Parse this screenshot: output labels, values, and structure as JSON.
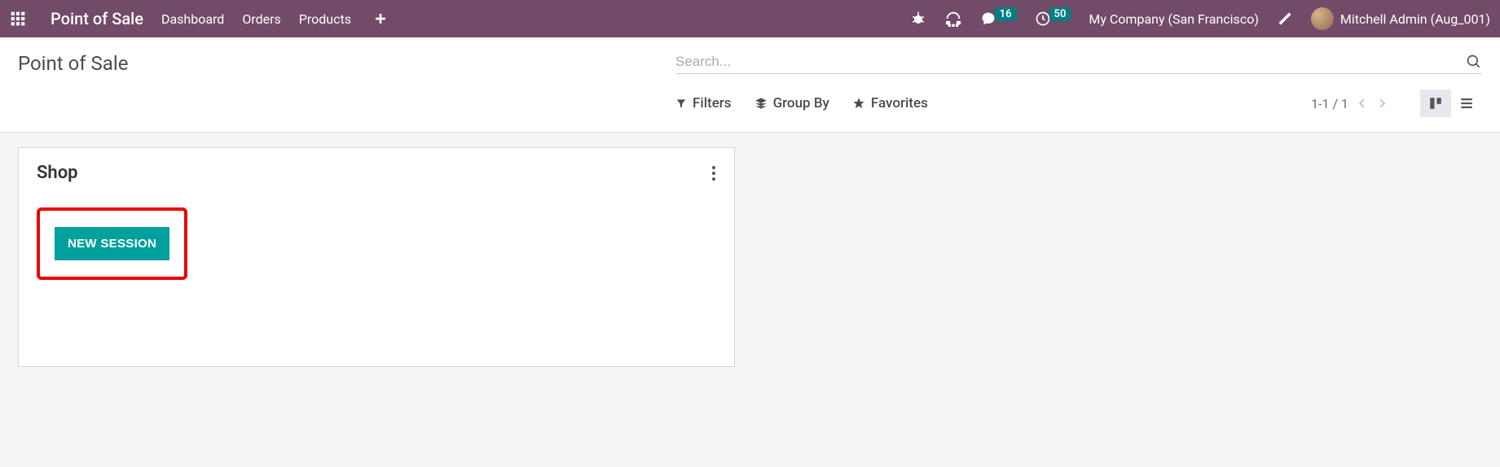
{
  "topnav": {
    "app_name": "Point of Sale",
    "menu": [
      "Dashboard",
      "Orders",
      "Products"
    ],
    "messages_badge": "16",
    "activities_badge": "50",
    "company": "My Company (San Francisco)",
    "user": "Mitchell Admin (Aug_001)"
  },
  "control": {
    "page_title": "Point of Sale",
    "search_placeholder": "Search...",
    "filters_label": "Filters",
    "groupby_label": "Group By",
    "favorites_label": "Favorites",
    "pager": "1-1 / 1"
  },
  "card": {
    "title": "Shop",
    "new_session_label": "NEW SESSION"
  }
}
